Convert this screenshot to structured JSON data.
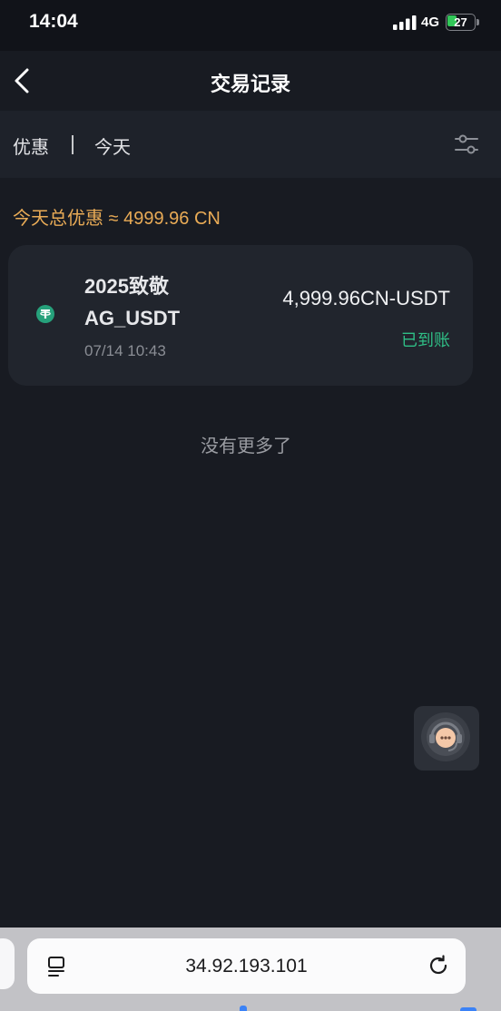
{
  "status_bar": {
    "time": "14:04",
    "network": "4G",
    "battery_level": "27",
    "battery_color": "#32c759"
  },
  "nav": {
    "title": "交易记录",
    "back_icon": "chevron-left-icon"
  },
  "filter": {
    "type_label": "优惠",
    "date_label": "今天",
    "settings_icon": "sliders-icon"
  },
  "summary": {
    "text": "今天总优惠 ≈ 4999.96 CN",
    "color": "#e9ab56"
  },
  "records": [
    {
      "token_icon": "tether-usdt-icon",
      "name": "2025致敬AG_USDT",
      "time": "07/14 10:43",
      "amount": "4,999.96CN-USDT",
      "status": "已到账",
      "status_color": "#2fbf86"
    }
  ],
  "list_footer": "没有更多了",
  "support": {
    "icon": "customer-service-icon"
  },
  "browser": {
    "url": "34.92.193.101",
    "menu_icon": "page-menu-icon",
    "reload_icon": "reload-icon"
  }
}
